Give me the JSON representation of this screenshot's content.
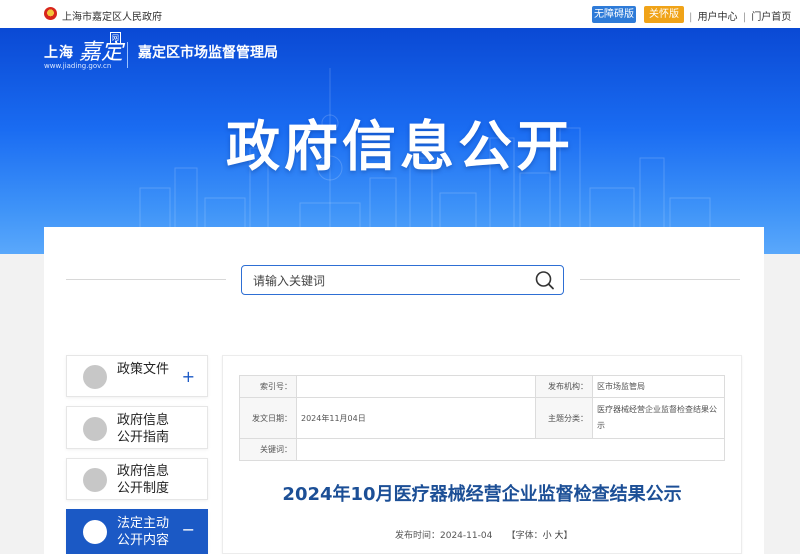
{
  "topbar": {
    "gov_name": "上海市嘉定区人民政府",
    "accessibility_label": "无障碍版",
    "care_label": "关怀版",
    "user_center": "用户中心",
    "portal_home": "门户首页",
    "separator": "|"
  },
  "banner": {
    "logo_shanghai": "上海",
    "logo_jiading": "嘉定",
    "logo_badge": "网",
    "logo_url": "www.jiading.gov.cn",
    "bureau": "嘉定区市场监督管理局",
    "title": "政府信息公开"
  },
  "search": {
    "placeholder": "请输入关键词"
  },
  "sidebar": {
    "items": [
      {
        "label": "政策文件",
        "icon": "document-icon",
        "toggle": "+"
      },
      {
        "label": "政府信息\n公开指南",
        "icon": "guide-icon"
      },
      {
        "label": "政府信息\n公开制度",
        "icon": "regulation-icon"
      },
      {
        "label": "法定主动\n公开内容",
        "icon": "content-icon",
        "toggle": "−",
        "active": true
      }
    ]
  },
  "meta": {
    "index_label": "索引号：",
    "index_value": "",
    "publisher_label": "发布机构：",
    "publisher_value": "区市场监管局",
    "date_label": "发文日期：",
    "date_value": "2024年11月04日",
    "category_label": "主题分类：",
    "category_value": "医疗器械经营企业监督检查结果公示",
    "keywords_label": "关键词：",
    "keywords_value": ""
  },
  "document": {
    "title": "2024年10月医疗器械经营企业监督检查结果公示",
    "publish_time": "发布时间：2024-11-04",
    "font_label": "【字体：",
    "font_small": "小",
    "font_large": "大",
    "font_close": "】"
  },
  "colors": {
    "primary": "#1b59c5",
    "banner": "#1a6cf2",
    "care": "#f0a318",
    "title": "#1c4f96"
  }
}
